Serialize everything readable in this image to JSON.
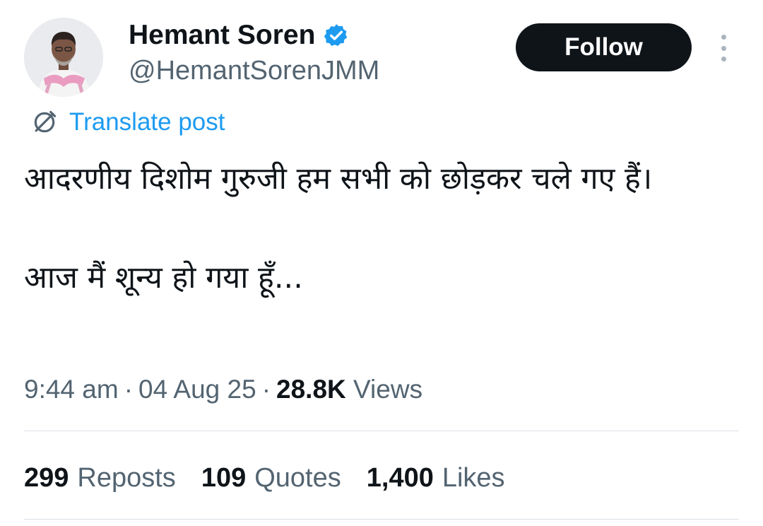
{
  "author": {
    "name": "Hemant Soren",
    "handle": "@HemantSorenJMM",
    "verified": true,
    "verified_color": "#1d9bf0"
  },
  "follow_label": "Follow",
  "translate_label": "Translate post",
  "post": {
    "line1": "आदरणीय दिशोम गुरुजी हम सभी को छोड़कर चले गए हैं।",
    "line2": "आज मैं शून्य हो गया हूँ..."
  },
  "meta": {
    "time": "9:44 am",
    "date": "04 Aug 25",
    "views_count": "28.8K",
    "views_label": "Views"
  },
  "stats": {
    "reposts_count": "299",
    "reposts_label": "Reposts",
    "quotes_count": "109",
    "quotes_label": "Quotes",
    "likes_count": "1,400",
    "likes_label": "Likes"
  },
  "colors": {
    "accent": "#1d9bf0",
    "text": "#0f1419",
    "muted": "#536471",
    "button_bg": "#0f1419"
  }
}
